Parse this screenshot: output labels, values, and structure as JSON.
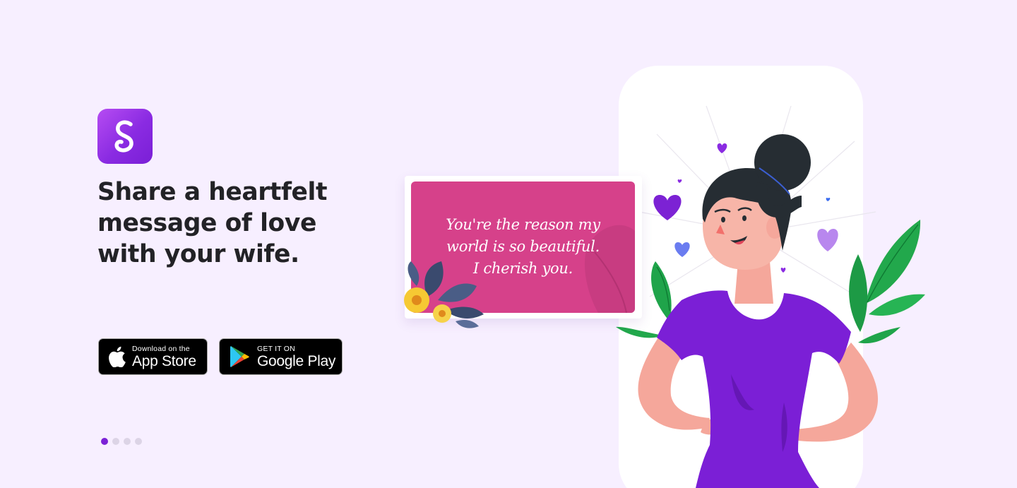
{
  "app": {
    "logo_letter": "S"
  },
  "headline": "Share a heartfelt message of love with your wife.",
  "stores": {
    "apple": {
      "small": "Download on the",
      "big": "App Store"
    },
    "google": {
      "small": "GET IT ON",
      "big": "Google Play"
    }
  },
  "card": {
    "lines": [
      "You're the reason my",
      "world is so beautiful.",
      "I cherish you."
    ]
  },
  "carousel": {
    "total": 4,
    "active_index": 0
  },
  "colors": {
    "background": "#f7efff",
    "brand_purple": "#7b21d6",
    "card_pink": "#d6418a",
    "headline": "#222226"
  },
  "icons": [
    "app-logo-icon",
    "apple-icon",
    "google-play-icon"
  ]
}
